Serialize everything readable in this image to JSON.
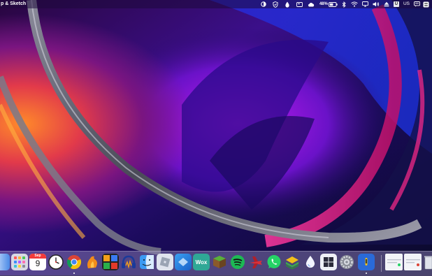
{
  "menubar": {
    "app_name": "p & Sketch",
    "battery_percent": "48%",
    "input_language": "US",
    "keyboard_badge": "U",
    "status_icons": [
      "contrast-icon",
      "shield-icon",
      "drop-icon",
      "display-icon",
      "cloud-icon",
      "battery-icon",
      "bluetooth-icon",
      "wifi-icon",
      "screen-mirror-icon",
      "volume-icon",
      "eject-icon",
      "keyboard-icon",
      "language-icon",
      "chat-icon",
      "control-center-icon"
    ]
  },
  "dock": {
    "calendar_month": "Sep",
    "calendar_day": "9",
    "wox_label": "Wox",
    "apps": [
      "finder",
      "launchpad",
      "calendar",
      "clock",
      "chrome",
      "fl-studio",
      "winamp",
      "audacity",
      "finder-2",
      "roblox",
      "sketch",
      "wox",
      "minecraft",
      "spotify",
      "airplane-game",
      "whatsapp",
      "layers",
      "water",
      "windows",
      "system-preferences",
      "app",
      "screenshot-1",
      "screenshot-2",
      "trash"
    ]
  },
  "colors": {
    "menubar_bg": "#2a0f4a",
    "dock_bg": "#9a90c0",
    "chrome_red": "#db4437",
    "spotify_green": "#1db954",
    "whatsapp_green": "#25d366"
  }
}
